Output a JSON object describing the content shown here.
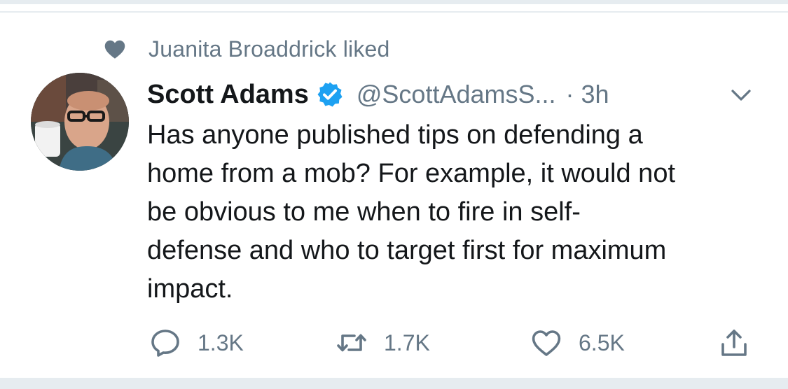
{
  "social_context": {
    "icon": "heart-icon",
    "text": "Juanita Broaddrick liked"
  },
  "tweet": {
    "author_name": "Scott Adams",
    "verified_icon": "verified-badge-icon",
    "handle": "@ScottAdamsS...",
    "separator": "·",
    "time": "3h",
    "menu_icon": "chevron-down-icon",
    "body_lines": [
      "Has anyone published tips on defending a",
      "home from a mob? For example, it would not",
      "be obvious to me when to fire in self-",
      "defense and who to target first for maximum",
      "impact."
    ]
  },
  "actions": {
    "reply": {
      "icon": "reply-icon",
      "count": "1.3K"
    },
    "retweet": {
      "icon": "retweet-icon",
      "count": "1.7K"
    },
    "like": {
      "icon": "like-heart-icon",
      "count": "6.5K"
    },
    "share": {
      "icon": "share-icon"
    }
  },
  "colors": {
    "text_primary": "#14171a",
    "text_secondary": "#657786",
    "verified_blue": "#1da1f2",
    "divider": "#e6ecf0"
  }
}
